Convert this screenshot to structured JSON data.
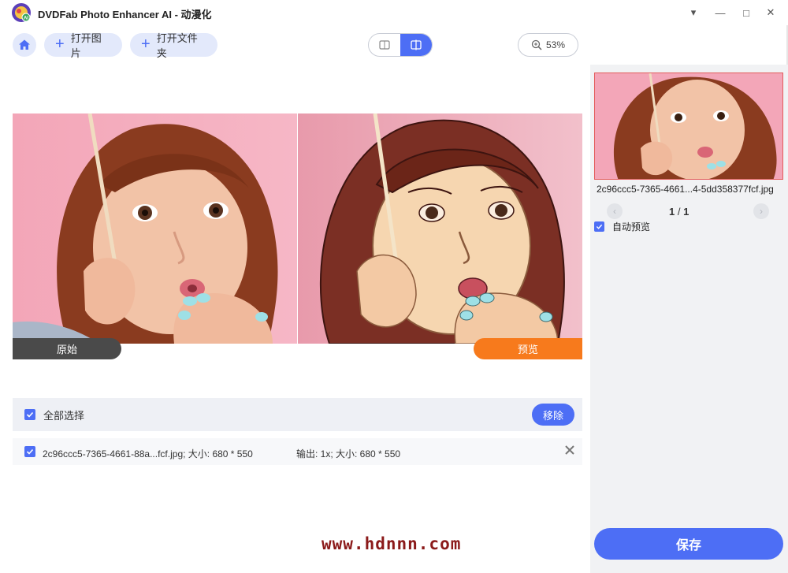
{
  "window": {
    "title": "DVDFab Photo Enhancer AI - 动漫化",
    "controls": {
      "dropdown": "▾",
      "minimize": "—",
      "maximize": "□",
      "close": "✕"
    }
  },
  "toolbar": {
    "open_image": "打开图片",
    "open_folder": "打开文件夹",
    "zoom_level": "53%"
  },
  "preview": {
    "original_label": "原始",
    "preview_label": "预览"
  },
  "file_list": {
    "select_all_label": "全部选择",
    "remove_label": "移除",
    "items": [
      {
        "file_info": "2c96ccc5-7365-4661-88a...fcf.jpg; 大小: 680 * 550",
        "output_info": "输出: 1x; 大小: 680 * 550"
      }
    ]
  },
  "side_panel": {
    "thumb_name": "2c96ccc5-7365-4661...4-5dd358377fcf.jpg",
    "page_current": "1",
    "page_sep": " / ",
    "page_total": "1",
    "auto_preview_label": "自动预览",
    "save_label": "保存"
  },
  "watermark": "www.hdnnn.com",
  "colors": {
    "accent": "#4d6ef5",
    "preview_tag": "#f77a1c",
    "original_tag": "#4a4a4a",
    "toolbar_pill": "#e3e9fb",
    "watermark": "#8b1a1a"
  }
}
